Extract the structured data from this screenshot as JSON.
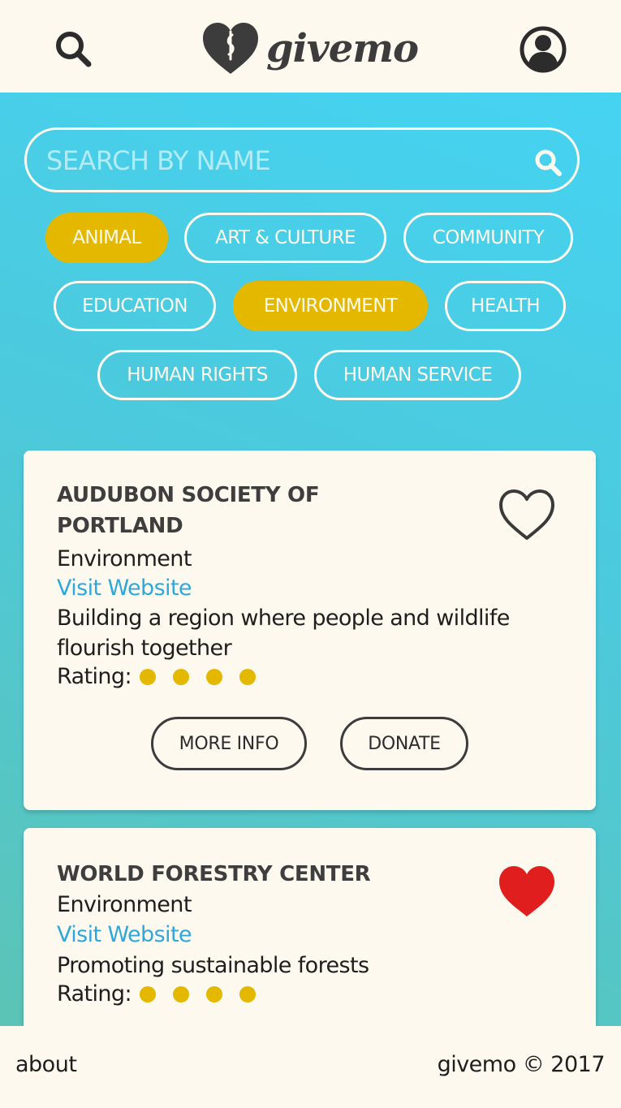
{
  "app": {
    "name": "givemo"
  },
  "header": {
    "logo_text": "givemo",
    "search_icon": "search-icon",
    "account_icon": "user-account-icon"
  },
  "search": {
    "placeholder": "SEARCH BY NAME",
    "value": "",
    "icon": "search-icon"
  },
  "categories": [
    {
      "label": "ANIMAL",
      "selected": true
    },
    {
      "label": "ART & CULTURE",
      "selected": false
    },
    {
      "label": "COMMUNITY",
      "selected": false
    },
    {
      "label": "EDUCATION",
      "selected": false
    },
    {
      "label": "ENVIRONMENT",
      "selected": true
    },
    {
      "label": "HEALTH",
      "selected": false
    },
    {
      "label": "HUMAN RIGHTS",
      "selected": false
    },
    {
      "label": "HUMAN SERVICE",
      "selected": false
    }
  ],
  "results": [
    {
      "name_lines": [
        "AUDUBON SOCIETY OF",
        "PORTLAND"
      ],
      "category": "Environment",
      "link_text": "Visit Website",
      "description_lines": [
        "Building a region where people and wildlife",
        "flourish together"
      ],
      "rating_label": "Rating:",
      "rating": 4,
      "favorited": false,
      "more_info_label": "MORE INFO",
      "donate_label": "DONATE"
    },
    {
      "name_lines": [
        "WORLD FORESTRY CENTER"
      ],
      "category": "Environment",
      "link_text": "Visit Website",
      "description_lines": [
        "Promoting sustainable forests"
      ],
      "rating_label": "Rating:",
      "rating": 4,
      "favorited": true
    }
  ],
  "footer": {
    "about": "about",
    "copyright": "givemo © 2017"
  },
  "colors": {
    "background": "#fdf9ef",
    "accent_yellow": "#e5b800",
    "gradient_top": "#45d3f2",
    "gradient_bottom": "#5cc4b6",
    "link": "#2ea8dc",
    "favorite_red": "#e01e1e",
    "text_dark": "#3c3c3c"
  }
}
